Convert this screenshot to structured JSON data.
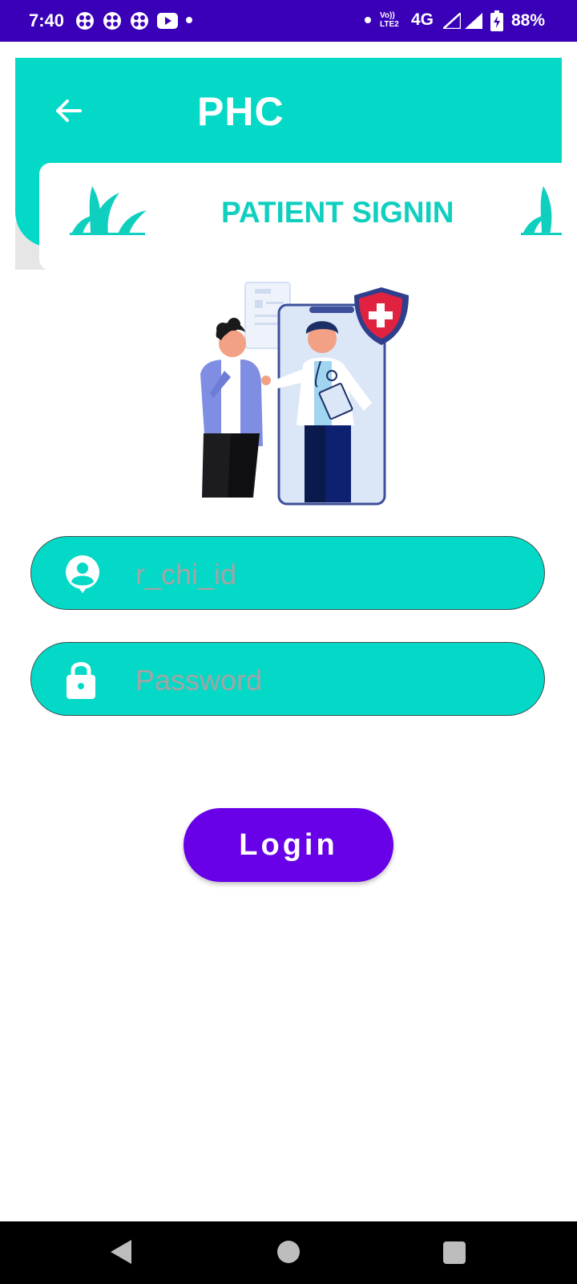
{
  "status_bar": {
    "time": "7:40",
    "network": "4G",
    "volte_label": "Vo)) LTE2",
    "battery": "88%",
    "icons": [
      "fan-icon",
      "fan-icon",
      "fan-icon",
      "youtube-icon",
      "dot-icon",
      "dot-icon",
      "signal-icon",
      "signal-icon",
      "battery-icon"
    ]
  },
  "header": {
    "title": "PHC",
    "back_icon": "arrow-left-icon",
    "color": "#03d9c6"
  },
  "subheader": {
    "title": "PATIENT SIGNIN"
  },
  "form": {
    "id_field": {
      "placeholder": "r_chi_id",
      "value": "",
      "icon": "account-circle-icon"
    },
    "password_field": {
      "placeholder": "Password",
      "value": "",
      "icon": "lock-icon"
    },
    "login_label": "Login",
    "login_color": "#6800e8"
  },
  "nav": {
    "back": "triangle-back-icon",
    "home": "circle-home-icon",
    "recents": "square-recents-icon"
  }
}
